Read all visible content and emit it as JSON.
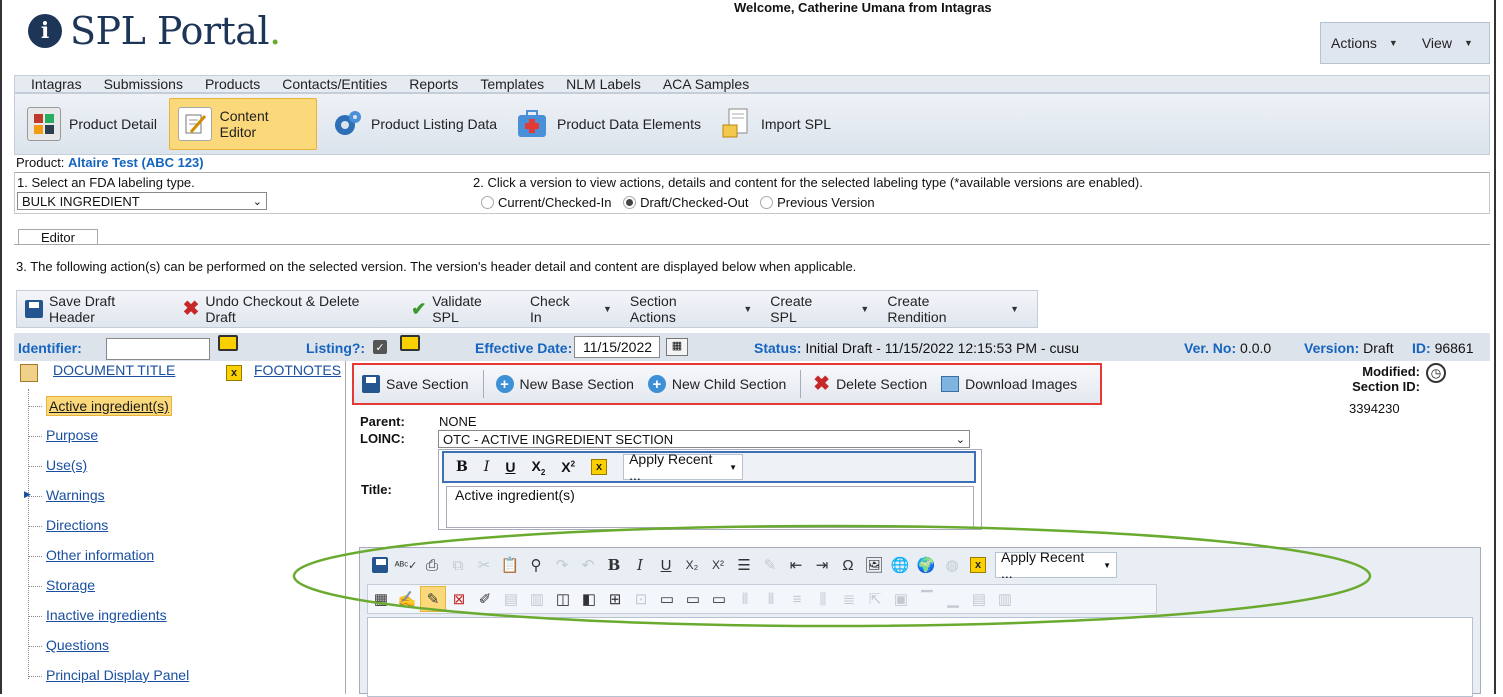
{
  "header": {
    "logo_letter": "i",
    "logo_text": "SPL Portal",
    "logo_dot": ".",
    "welcome": "Welcome, Catherine Umana from Intagras",
    "actions_label": "Actions",
    "view_label": "View"
  },
  "menu": [
    "Intagras",
    "Submissions",
    "Products",
    "Contacts/Entities",
    "Reports",
    "Templates",
    "NLM Labels",
    "ACA Samples"
  ],
  "iconbar": {
    "product_detail": "Product Detail",
    "content_editor": "Content Editor",
    "product_listing": "Product Listing Data",
    "product_data_elements": "Product Data Elements",
    "import_spl": "Import SPL"
  },
  "product": {
    "label": "Product:",
    "name": "Altaire Test (ABC 123)"
  },
  "step1": {
    "label": "1. Select an FDA labeling type.",
    "value": "BULK INGREDIENT"
  },
  "step2": {
    "label": "2. Click a version to view actions, details and content for the selected labeling type (*available versions are enabled).",
    "opt_current": "Current/Checked-In",
    "opt_draft": "Draft/Checked-Out",
    "opt_previous": "Previous Version"
  },
  "tab_editor": "Editor",
  "step3": "3. The following action(s) can be performed on the selected version. The version's header detail and content are displayed below when applicable.",
  "actions": {
    "save_draft_header": "Save Draft Header",
    "undo_checkout": "Undo Checkout & Delete Draft",
    "validate": "Validate SPL",
    "check_in": "Check In",
    "section_actions": "Section Actions",
    "create_spl": "Create SPL",
    "create_rendition": "Create Rendition"
  },
  "idrow": {
    "identifier_label": "Identifier:",
    "listing_label": "Listing?:",
    "effective_label": "Effective Date:",
    "effective_value": "11/15/2022",
    "status_label": "Status:",
    "status_value": "Initial Draft - 11/15/2022 12:15:53 PM - cusu",
    "verno_label": "Ver. No:",
    "verno_value": "0.0.0",
    "version_label": "Version:",
    "version_value": "Draft",
    "id_label": "ID:",
    "id_value": "96861"
  },
  "tree": {
    "document_title": "DOCUMENT TITLE",
    "footnotes": "FOOTNOTES",
    "items": [
      "Active ingredient(s)",
      "Purpose",
      "Use(s)",
      "Warnings",
      "Directions",
      "Other information",
      "Storage",
      "Inactive ingredients",
      "Questions",
      "Principal Display Panel"
    ]
  },
  "section_toolbar": {
    "save": "Save Section",
    "new_base": "New Base Section",
    "new_child": "New Child Section",
    "delete": "Delete Section",
    "download": "Download Images"
  },
  "section_info": {
    "modified_label": "Modified:",
    "section_id_label": "Section ID:",
    "section_id_value": "3394230",
    "parent_label": "Parent:",
    "parent_value": "NONE",
    "loinc_label": "LOINC:",
    "loinc_value": "OTC - ACTIVE INGREDIENT SECTION",
    "title_label": "Title:",
    "title_value": "Active ingredient(s)"
  },
  "editor": {
    "apply_recent": "Apply Recent ...",
    "apply_recent_2": "Apply Recent ..."
  },
  "colors": {
    "highlight_red": "#e53935",
    "highlight_blue": "#3f6fb5",
    "highlight_green": "#6aaa2e",
    "active_tab": "#fbd97a"
  }
}
